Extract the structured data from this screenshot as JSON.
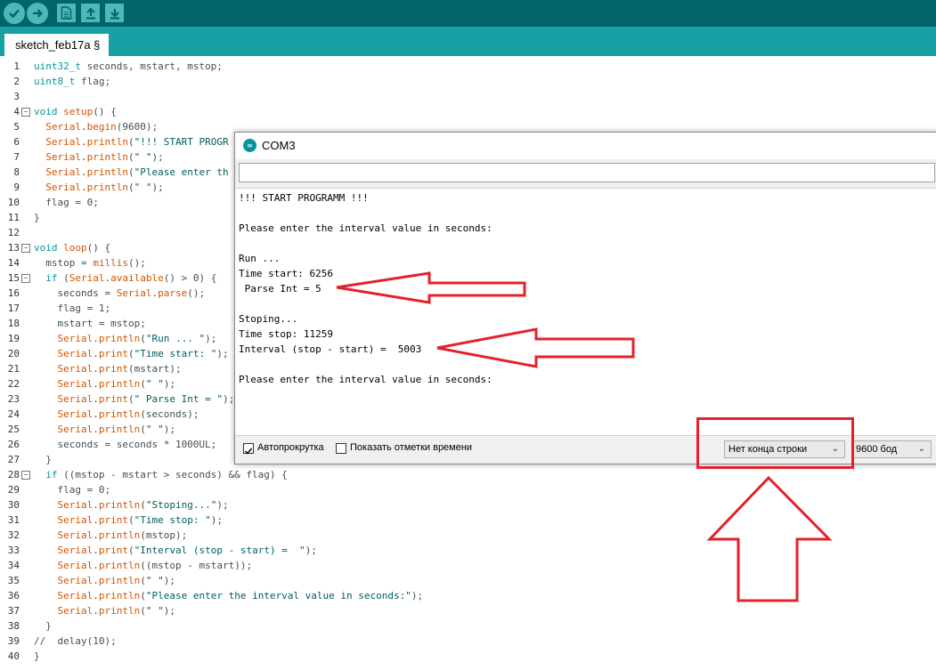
{
  "toolbar": {
    "buttons": [
      "verify-icon",
      "upload-icon",
      "new-icon",
      "open-icon",
      "save-icon"
    ]
  },
  "tab": {
    "label": "sketch_feb17a §"
  },
  "line_numbers": [
    "1",
    "2",
    "3",
    "4",
    "5",
    "6",
    "7",
    "8",
    "9",
    "10",
    "11",
    "12",
    "13",
    "14",
    "15",
    "16",
    "17",
    "18",
    "19",
    "20",
    "21",
    "22",
    "23",
    "24",
    "25",
    "26",
    "27",
    "28",
    "29",
    "30",
    "31",
    "32",
    "33",
    "34",
    "35",
    "36",
    "37",
    "38",
    "39",
    "40"
  ],
  "code_lines": [
    [
      {
        "t": "uint32_t",
        "c": "kt"
      },
      {
        "t": " seconds, mstart, mstop;",
        "c": ""
      }
    ],
    [
      {
        "t": "uint8_t",
        "c": "kt"
      },
      {
        "t": " flag;",
        "c": ""
      }
    ],
    [],
    [
      {
        "t": "void",
        "c": "kt"
      },
      {
        "t": " ",
        "c": ""
      },
      {
        "t": "setup",
        "c": "kf"
      },
      {
        "t": "() {",
        "c": ""
      }
    ],
    [
      {
        "t": "  ",
        "c": ""
      },
      {
        "t": "Serial",
        "c": "kf"
      },
      {
        "t": ".",
        "c": ""
      },
      {
        "t": "begin",
        "c": "kf"
      },
      {
        "t": "(9600);",
        "c": ""
      }
    ],
    [
      {
        "t": "  ",
        "c": ""
      },
      {
        "t": "Serial",
        "c": "kf"
      },
      {
        "t": ".",
        "c": ""
      },
      {
        "t": "println",
        "c": "kf"
      },
      {
        "t": "(",
        "c": ""
      },
      {
        "t": "\"!!! START PROGR",
        "c": "str"
      }
    ],
    [
      {
        "t": "  ",
        "c": ""
      },
      {
        "t": "Serial",
        "c": "kf"
      },
      {
        "t": ".",
        "c": ""
      },
      {
        "t": "println",
        "c": "kf"
      },
      {
        "t": "(",
        "c": ""
      },
      {
        "t": "\" \"",
        "c": "str"
      },
      {
        "t": ");",
        "c": ""
      }
    ],
    [
      {
        "t": "  ",
        "c": ""
      },
      {
        "t": "Serial",
        "c": "kf"
      },
      {
        "t": ".",
        "c": ""
      },
      {
        "t": "println",
        "c": "kf"
      },
      {
        "t": "(",
        "c": ""
      },
      {
        "t": "\"Please enter th",
        "c": "str"
      }
    ],
    [
      {
        "t": "  ",
        "c": ""
      },
      {
        "t": "Serial",
        "c": "kf"
      },
      {
        "t": ".",
        "c": ""
      },
      {
        "t": "println",
        "c": "kf"
      },
      {
        "t": "(",
        "c": ""
      },
      {
        "t": "\" \"",
        "c": "str"
      },
      {
        "t": ");",
        "c": ""
      }
    ],
    [
      {
        "t": "  flag = 0;",
        "c": ""
      }
    ],
    [
      {
        "t": "}",
        "c": ""
      }
    ],
    [],
    [
      {
        "t": "void",
        "c": "kt"
      },
      {
        "t": " ",
        "c": ""
      },
      {
        "t": "loop",
        "c": "kf"
      },
      {
        "t": "() {",
        "c": ""
      }
    ],
    [
      {
        "t": "  mstop = ",
        "c": ""
      },
      {
        "t": "millis",
        "c": "kf"
      },
      {
        "t": "();",
        "c": ""
      }
    ],
    [
      {
        "t": "  ",
        "c": ""
      },
      {
        "t": "if",
        "c": "kt"
      },
      {
        "t": " (",
        "c": ""
      },
      {
        "t": "Serial",
        "c": "kf"
      },
      {
        "t": ".",
        "c": ""
      },
      {
        "t": "available",
        "c": "kf"
      },
      {
        "t": "() > 0) {",
        "c": ""
      }
    ],
    [
      {
        "t": "    seconds = ",
        "c": ""
      },
      {
        "t": "Serial",
        "c": "kf"
      },
      {
        "t": ".",
        "c": ""
      },
      {
        "t": "parse",
        "c": "kf"
      },
      {
        "t": "();",
        "c": ""
      }
    ],
    [
      {
        "t": "    flag = 1;",
        "c": ""
      }
    ],
    [
      {
        "t": "    mstart = mstop;",
        "c": ""
      }
    ],
    [
      {
        "t": "    ",
        "c": ""
      },
      {
        "t": "Serial",
        "c": "kf"
      },
      {
        "t": ".",
        "c": ""
      },
      {
        "t": "println",
        "c": "kf"
      },
      {
        "t": "(",
        "c": ""
      },
      {
        "t": "\"Run ... \"",
        "c": "str"
      },
      {
        "t": ");",
        "c": ""
      }
    ],
    [
      {
        "t": "    ",
        "c": ""
      },
      {
        "t": "Serial",
        "c": "kf"
      },
      {
        "t": ".",
        "c": ""
      },
      {
        "t": "print",
        "c": "kf"
      },
      {
        "t": "(",
        "c": ""
      },
      {
        "t": "\"Time start: \"",
        "c": "str"
      },
      {
        "t": ");",
        "c": ""
      }
    ],
    [
      {
        "t": "    ",
        "c": ""
      },
      {
        "t": "Serial",
        "c": "kf"
      },
      {
        "t": ".",
        "c": ""
      },
      {
        "t": "print",
        "c": "kf"
      },
      {
        "t": "(mstart);",
        "c": ""
      }
    ],
    [
      {
        "t": "    ",
        "c": ""
      },
      {
        "t": "Serial",
        "c": "kf"
      },
      {
        "t": ".",
        "c": ""
      },
      {
        "t": "println",
        "c": "kf"
      },
      {
        "t": "(",
        "c": ""
      },
      {
        "t": "\" \"",
        "c": "str"
      },
      {
        "t": ");",
        "c": ""
      }
    ],
    [
      {
        "t": "    ",
        "c": ""
      },
      {
        "t": "Serial",
        "c": "kf"
      },
      {
        "t": ".",
        "c": ""
      },
      {
        "t": "print",
        "c": "kf"
      },
      {
        "t": "(",
        "c": ""
      },
      {
        "t": "\" Parse Int = \"",
        "c": "str"
      },
      {
        "t": ");",
        "c": ""
      }
    ],
    [
      {
        "t": "    ",
        "c": ""
      },
      {
        "t": "Serial",
        "c": "kf"
      },
      {
        "t": ".",
        "c": ""
      },
      {
        "t": "println",
        "c": "kf"
      },
      {
        "t": "(seconds);",
        "c": ""
      }
    ],
    [
      {
        "t": "    ",
        "c": ""
      },
      {
        "t": "Serial",
        "c": "kf"
      },
      {
        "t": ".",
        "c": ""
      },
      {
        "t": "println",
        "c": "kf"
      },
      {
        "t": "(",
        "c": ""
      },
      {
        "t": "\" \"",
        "c": "str"
      },
      {
        "t": ");",
        "c": ""
      }
    ],
    [
      {
        "t": "    seconds = seconds * 1000UL;",
        "c": ""
      }
    ],
    [
      {
        "t": "  }",
        "c": ""
      }
    ],
    [
      {
        "t": "  ",
        "c": ""
      },
      {
        "t": "if",
        "c": "kt"
      },
      {
        "t": " ((mstop - mstart > seconds) && flag) {",
        "c": ""
      }
    ],
    [
      {
        "t": "    flag = 0;",
        "c": ""
      }
    ],
    [
      {
        "t": "    ",
        "c": ""
      },
      {
        "t": "Serial",
        "c": "kf"
      },
      {
        "t": ".",
        "c": ""
      },
      {
        "t": "println",
        "c": "kf"
      },
      {
        "t": "(",
        "c": ""
      },
      {
        "t": "\"Stoping...\"",
        "c": "str"
      },
      {
        "t": ");",
        "c": ""
      }
    ],
    [
      {
        "t": "    ",
        "c": ""
      },
      {
        "t": "Serial",
        "c": "kf"
      },
      {
        "t": ".",
        "c": ""
      },
      {
        "t": "print",
        "c": "kf"
      },
      {
        "t": "(",
        "c": ""
      },
      {
        "t": "\"Time stop: \"",
        "c": "str"
      },
      {
        "t": ");",
        "c": ""
      }
    ],
    [
      {
        "t": "    ",
        "c": ""
      },
      {
        "t": "Serial",
        "c": "kf"
      },
      {
        "t": ".",
        "c": ""
      },
      {
        "t": "println",
        "c": "kf"
      },
      {
        "t": "(mstop);",
        "c": ""
      }
    ],
    [
      {
        "t": "    ",
        "c": ""
      },
      {
        "t": "Serial",
        "c": "kf"
      },
      {
        "t": ".",
        "c": ""
      },
      {
        "t": "print",
        "c": "kf"
      },
      {
        "t": "(",
        "c": ""
      },
      {
        "t": "\"Interval (stop - start) =  \"",
        "c": "str"
      },
      {
        "t": ");",
        "c": ""
      }
    ],
    [
      {
        "t": "    ",
        "c": ""
      },
      {
        "t": "Serial",
        "c": "kf"
      },
      {
        "t": ".",
        "c": ""
      },
      {
        "t": "println",
        "c": "kf"
      },
      {
        "t": "((mstop - mstart));",
        "c": ""
      }
    ],
    [
      {
        "t": "    ",
        "c": ""
      },
      {
        "t": "Serial",
        "c": "kf"
      },
      {
        "t": ".",
        "c": ""
      },
      {
        "t": "println",
        "c": "kf"
      },
      {
        "t": "(",
        "c": ""
      },
      {
        "t": "\" \"",
        "c": "str"
      },
      {
        "t": ");",
        "c": ""
      }
    ],
    [
      {
        "t": "    ",
        "c": ""
      },
      {
        "t": "Serial",
        "c": "kf"
      },
      {
        "t": ".",
        "c": ""
      },
      {
        "t": "println",
        "c": "kf"
      },
      {
        "t": "(",
        "c": ""
      },
      {
        "t": "\"Please enter the interval value in seconds:\"",
        "c": "str"
      },
      {
        "t": ");",
        "c": ""
      }
    ],
    [
      {
        "t": "    ",
        "c": ""
      },
      {
        "t": "Serial",
        "c": "kf"
      },
      {
        "t": ".",
        "c": ""
      },
      {
        "t": "println",
        "c": "kf"
      },
      {
        "t": "(",
        "c": ""
      },
      {
        "t": "\" \"",
        "c": "str"
      },
      {
        "t": ");",
        "c": ""
      }
    ],
    [
      {
        "t": "  }",
        "c": ""
      }
    ],
    [
      {
        "t": "//  delay(10);",
        "c": ""
      }
    ],
    [
      {
        "t": "}",
        "c": ""
      }
    ]
  ],
  "fold_markers": [
    "4",
    "13",
    "15",
    "28"
  ],
  "serial_monitor": {
    "title": "COM3",
    "icon": "arduino-icon",
    "close_icon": "close-icon",
    "input_value": "",
    "output_lines": [
      "!!! START PROGRAMM !!!",
      "",
      "Please enter the interval value in seconds:",
      "",
      "Run ...",
      "Time start: 6256",
      " Parse Int = 5",
      "",
      "Stoping...",
      "Time stop: 11259",
      "Interval (stop - start) =  5003",
      "",
      "Please enter the interval value in seconds:"
    ],
    "autoscroll_label": "Автопрокрутка",
    "autoscroll_checked": true,
    "timestamps_label": "Показать отметки времени",
    "timestamps_checked": false,
    "line_ending_selected": "Нет конца строки",
    "baud_selected": "9600 бод"
  },
  "annotations": {
    "color": "#e5202b"
  },
  "colors": {
    "toolbar_bg": "#006468",
    "tabbar_bg": "#17a1a5",
    "keyword_teal": "#00979c",
    "function_orange": "#d35400"
  }
}
